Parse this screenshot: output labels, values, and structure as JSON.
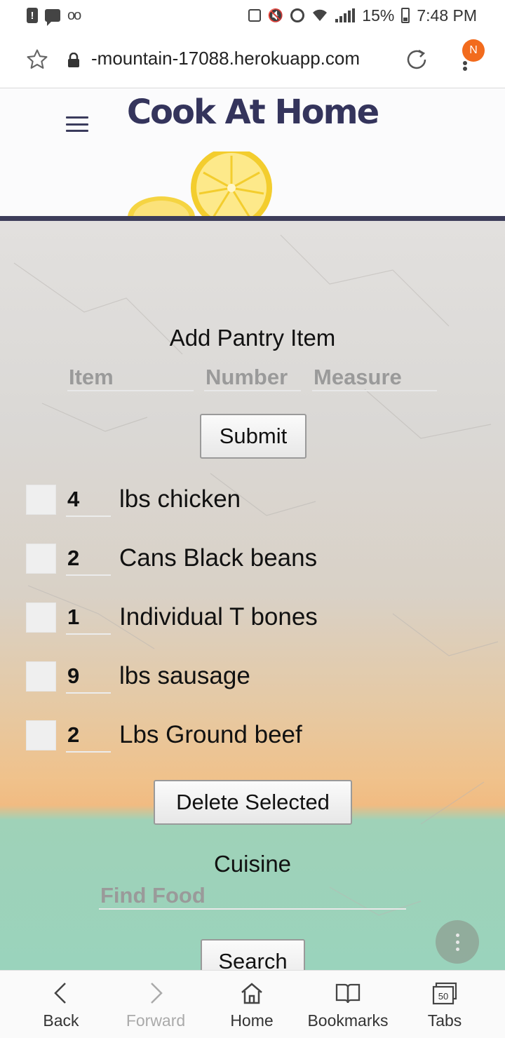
{
  "status_bar": {
    "battery": "15%",
    "time": "7:48 PM"
  },
  "browser": {
    "url": "-mountain-17088.herokuapp.com",
    "notification_badge": "N",
    "accent_color": "#f26b1d"
  },
  "header": {
    "title": "Cook At Home",
    "title_color": "#34345c"
  },
  "add_pantry": {
    "title": "Add Pantry Item",
    "item_placeholder": "Item",
    "number_placeholder": "Number",
    "measure_placeholder": "Measure",
    "submit_label": "Submit"
  },
  "pantry_items": [
    {
      "count": "4",
      "label": "lbs chicken"
    },
    {
      "count": "2",
      "label": "Cans Black beans"
    },
    {
      "count": "1",
      "label": "Individual T bones"
    },
    {
      "count": "9",
      "label": "lbs sausage"
    },
    {
      "count": "2",
      "label": "Lbs Ground beef"
    }
  ],
  "delete_label": "Delete Selected",
  "cuisine": {
    "title": "Cuisine",
    "search_placeholder": "Find Food",
    "search_label": "Search"
  },
  "bottom_nav": {
    "back": "Back",
    "forward": "Forward",
    "home": "Home",
    "bookmarks": "Bookmarks",
    "tabs": "Tabs",
    "tabs_count": "50"
  }
}
